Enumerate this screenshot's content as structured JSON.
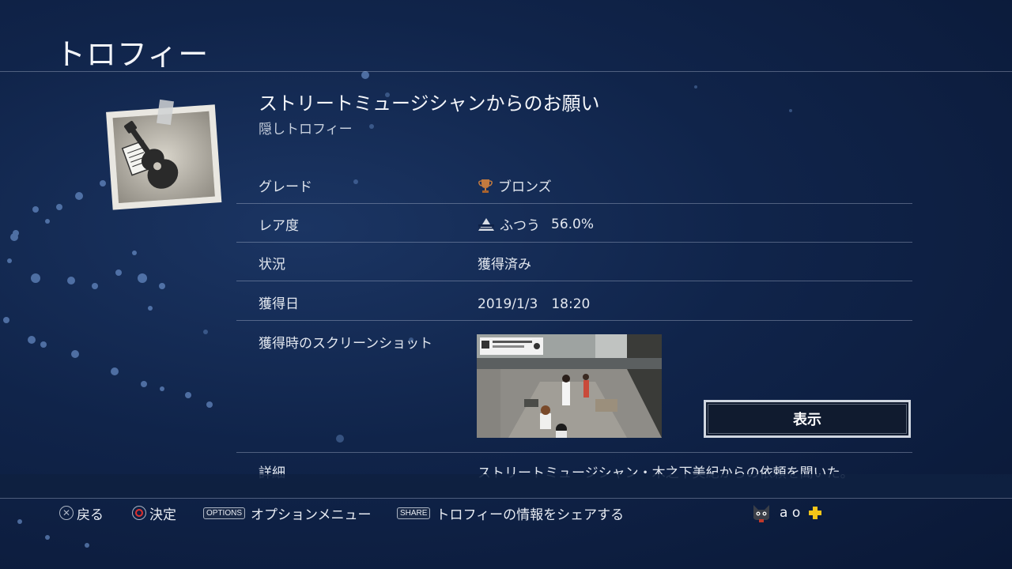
{
  "page": {
    "title": "トロフィー"
  },
  "trophy": {
    "name": "ストリートミュージシャンからのお願い",
    "subtitle": "隠しトロフィー",
    "image_icon": "guitar-photo-icon"
  },
  "details": {
    "grade_label": "グレード",
    "grade_value": "ブロンズ",
    "grade_icon": "bronze-trophy-icon",
    "rarity_label": "レア度",
    "rarity_value": "ふつう",
    "rarity_percent": "56.0%",
    "rarity_icon": "rarity-pyramid-icon",
    "status_label": "状況",
    "status_value": "獲得済み",
    "date_label": "獲得日",
    "date_value": "2019/1/3　18:20",
    "screenshot_label": "獲得時のスクリーンショット",
    "show_button": "表示",
    "description_label": "詳細",
    "description_value": "ストリートミュージシャン・木之下美紀からの依頼を聞いた。"
  },
  "footer": {
    "back": "戻る",
    "confirm": "決定",
    "options_tag": "OPTIONS",
    "options_label": "オプションメニュー",
    "share_tag": "SHARE",
    "share_label": "トロフィーの情報をシェアする"
  },
  "user": {
    "name": "a o",
    "avatar_icon": "cat-avatar-icon",
    "plus_icon": "ps-plus-icon"
  },
  "colors": {
    "bronze": "#b8733a",
    "ps_plus": "#f5c518",
    "circle_red": "#e0312f"
  }
}
